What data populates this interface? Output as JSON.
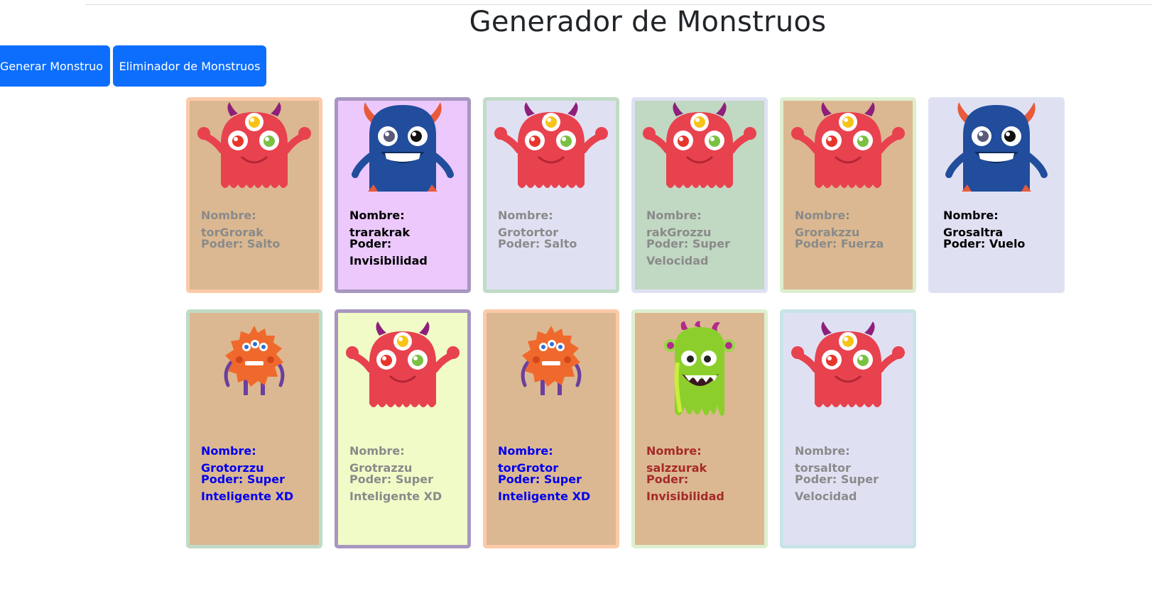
{
  "page": {
    "title": "Generador de Monstruos"
  },
  "buttons": {
    "generate": "Generar Monstruo",
    "remove": "Eliminador de Monstruos"
  },
  "cards": [
    {
      "name": "Nombre: torGrorak",
      "power": "Poder: Salto",
      "monster": "red-three-eyed",
      "bg": "#dbb891",
      "border": "#fccaa9",
      "text": "#8a8a8a"
    },
    {
      "name": "Nombre: trarakrak",
      "power": "Poder: Invisibilidad",
      "monster": "blue-horned",
      "bg": "#ecc8fd",
      "border": "#a797c0",
      "text": "#000000"
    },
    {
      "name": "Nombre: Grotortor",
      "power": "Poder: Salto",
      "monster": "red-three-eyed",
      "bg": "#dfe1f3",
      "border": "#c0dbc6",
      "text": "#8a8a8a"
    },
    {
      "name": "Nombre: rakGrozzu",
      "power": "Poder: Super Velocidad",
      "monster": "red-three-eyed",
      "bg": "#c1d8c3",
      "border": "#dfe1f3",
      "text": "#8a8a8a"
    },
    {
      "name": "Nombre: Grorakzzu",
      "power": "Poder: Fuerza",
      "monster": "red-three-eyed",
      "bg": "#dbb891",
      "border": "#deefd0",
      "text": "#8a8a8a"
    },
    {
      "name": "Nombre: Grosaltra",
      "power": "Poder: Vuelo",
      "monster": "blue-horned",
      "bg": "#dfe1f3",
      "border": "#dfe1f3",
      "text": "#000000"
    },
    {
      "name": "Nombre: Grotorzzu",
      "power": "Poder: Super Inteligente XD",
      "monster": "orange-furry",
      "bg": "#dbb891",
      "border": "#c0dbc6",
      "text": "#0000ee"
    },
    {
      "name": "Nombre: Grotrazzu",
      "power": "Poder: Super Inteligente XD",
      "monster": "red-three-eyed",
      "bg": "#f0fbc7",
      "border": "#a797c0",
      "text": "#8a8a8a"
    },
    {
      "name": "Nombre: torGrotor",
      "power": "Poder: Super Inteligente XD",
      "monster": "orange-furry",
      "bg": "#dbb891",
      "border": "#fccaa9",
      "text": "#0000ee"
    },
    {
      "name": "Nombre: salzzurak",
      "power": "Poder: Invisibilidad",
      "monster": "green-slime",
      "bg": "#dbb891",
      "border": "#deefd0",
      "text": "#a52a2a"
    },
    {
      "name": "Nombre: torsaltor",
      "power": "Poder: Super Velocidad",
      "monster": "red-three-eyed",
      "bg": "#dfe1f3",
      "border": "#c7e3e6",
      "text": "#8a8a8a"
    }
  ]
}
